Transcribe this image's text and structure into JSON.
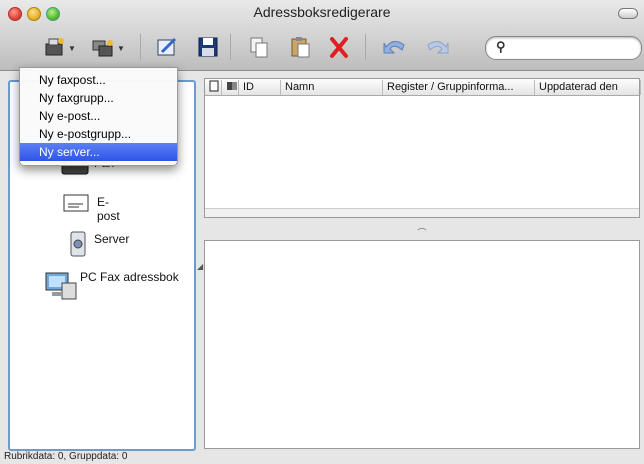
{
  "window": {
    "title": "Adressboksredigerare"
  },
  "toolbar": {
    "buttons": [
      "new-contact-icon",
      "new-group-icon",
      "edit-icon",
      "save-icon",
      "copy-icon",
      "paste-icon",
      "delete-icon",
      "undo-icon",
      "redo-icon"
    ],
    "search_placeholder": ""
  },
  "menu": {
    "items": [
      "Ny faxpost...",
      "Ny faxgrupp...",
      "Ny e-post...",
      "Ny e-postgrupp...",
      "Ny server..."
    ],
    "selected_index": 4
  },
  "sidebar": {
    "items": [
      {
        "label": "Fax",
        "icon": "fax-icon"
      },
      {
        "label": "E-post",
        "icon": "email-icon"
      },
      {
        "label": "Server",
        "icon": "server-icon"
      },
      {
        "label": "PC Fax adressbok",
        "icon": "pc-fax-icon"
      }
    ]
  },
  "table": {
    "columns": [
      "ID",
      "Namn",
      "Register / Gruppinforma...",
      "Uppdaterad den"
    ]
  },
  "status": {
    "text": "Rubrikdata: 0, Gruppdata: 0"
  }
}
